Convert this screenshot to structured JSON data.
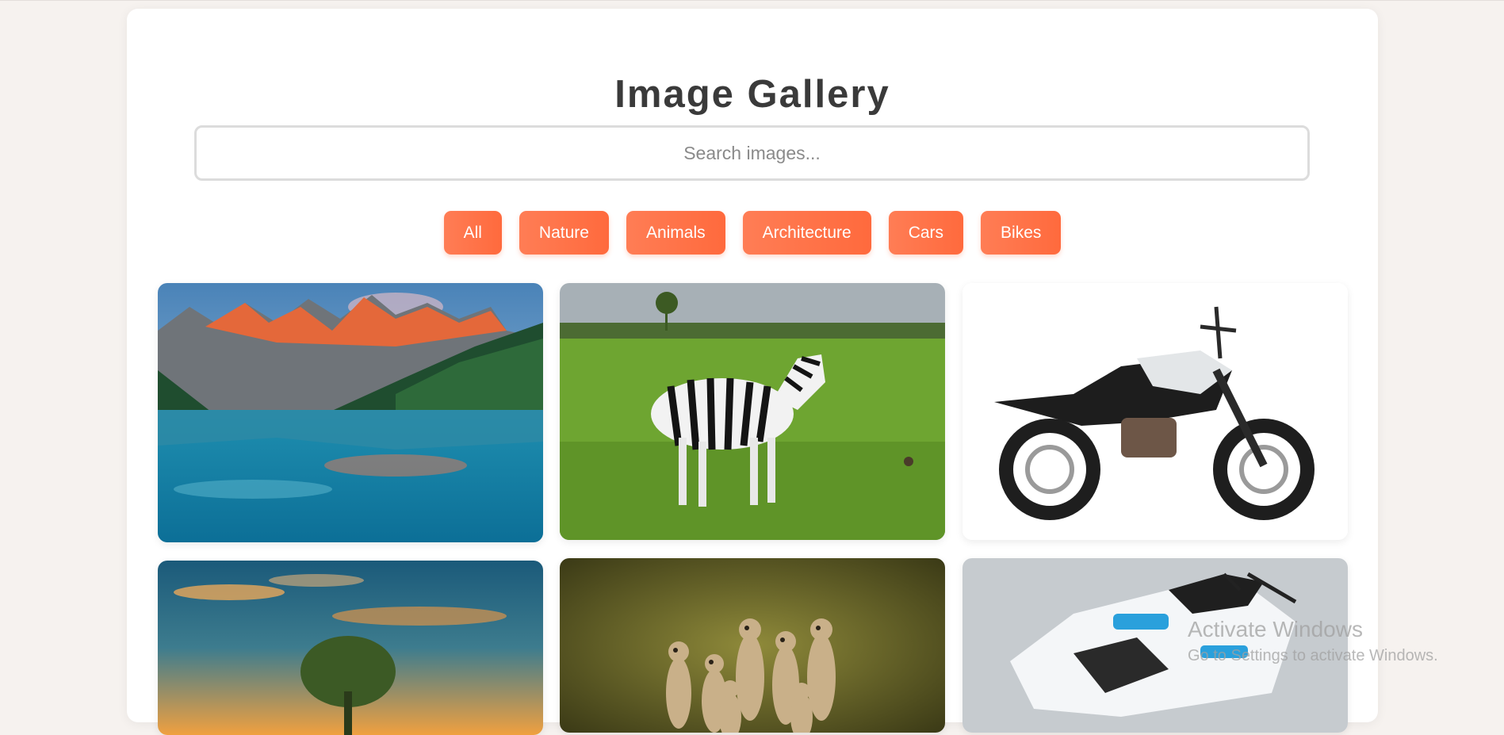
{
  "page": {
    "title": "Image Gallery"
  },
  "search": {
    "placeholder": "Search images...",
    "value": ""
  },
  "filters": [
    {
      "label": "All"
    },
    {
      "label": "Nature"
    },
    {
      "label": "Animals"
    },
    {
      "label": "Architecture"
    },
    {
      "label": "Cars"
    },
    {
      "label": "Bikes"
    }
  ],
  "gallery": [
    {
      "subject": "mountain lake reflection",
      "category": "Nature"
    },
    {
      "subject": "zebra on grassland",
      "category": "Animals"
    },
    {
      "subject": "naked motorcycle on white",
      "category": "Bikes"
    },
    {
      "subject": "tree at sunset",
      "category": "Nature"
    },
    {
      "subject": "group of meerkats",
      "category": "Animals"
    },
    {
      "subject": "white and blue sport motorcycle",
      "category": "Bikes"
    }
  ],
  "watermark": {
    "title": "Activate Windows",
    "subtitle": "Go to Settings to activate Windows."
  },
  "colors": {
    "accent": "#ff6a3d",
    "accent_light": "#ff7d55",
    "page_bg": "#f6f2ef",
    "card_bg": "#ffffff",
    "title_text": "#3a3a3a"
  }
}
